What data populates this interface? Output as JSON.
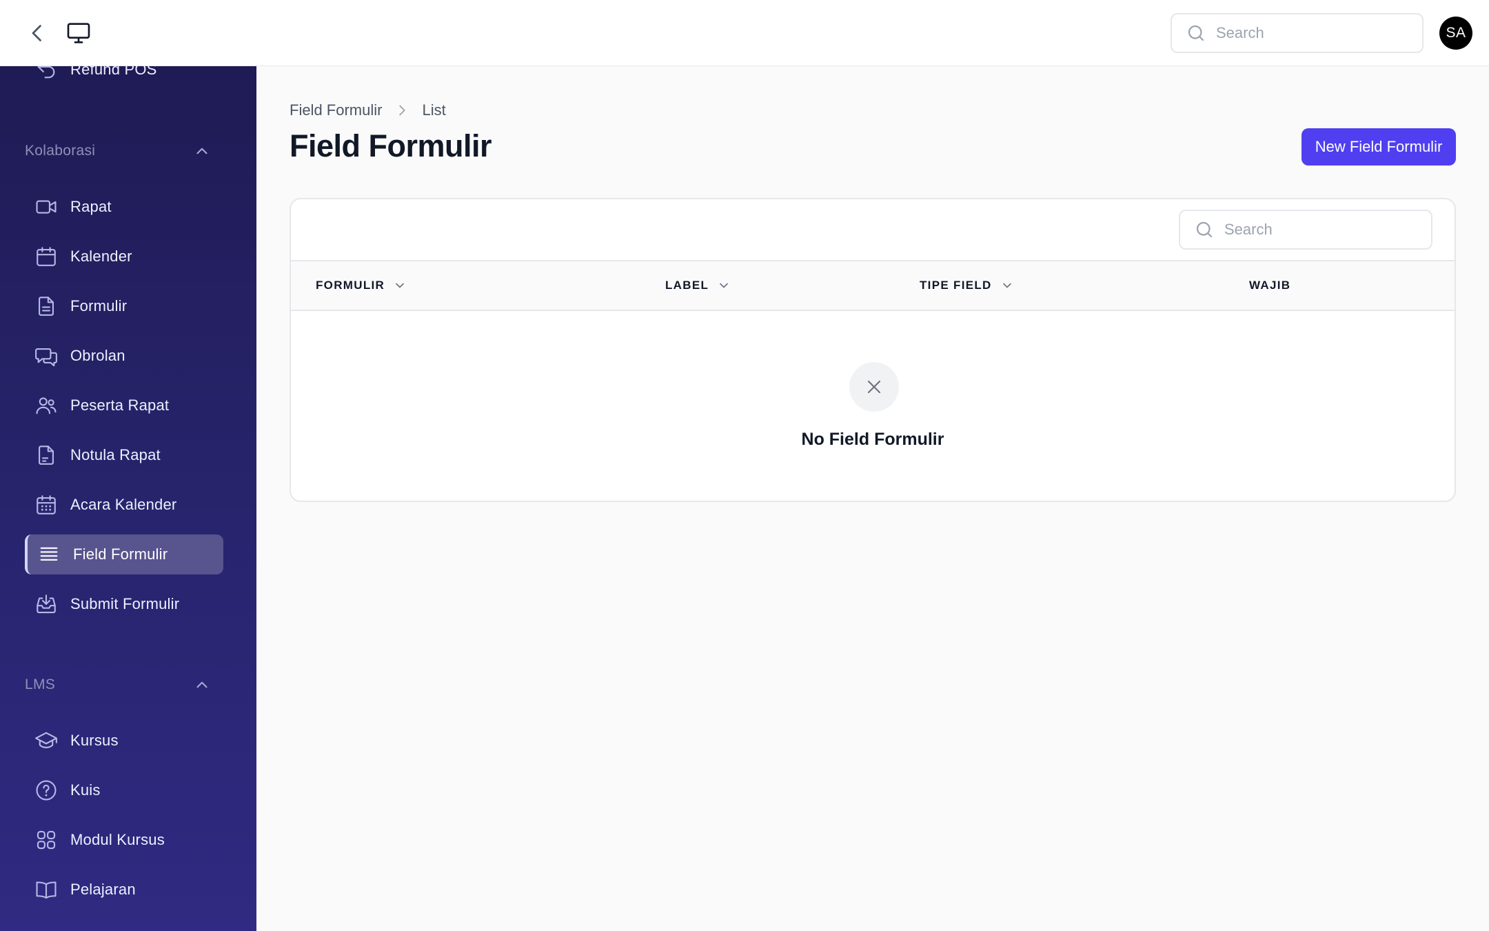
{
  "topbar": {
    "search_placeholder": "Search",
    "avatar_initials": "SA"
  },
  "sidebar": {
    "partial_item": {
      "label": "Refund POS",
      "icon": "undo-icon"
    },
    "groups": [
      {
        "label": "Kolaborasi",
        "expanded": true,
        "items": [
          {
            "label": "Rapat",
            "icon": "video-icon"
          },
          {
            "label": "Kalender",
            "icon": "calendar-icon"
          },
          {
            "label": "Formulir",
            "icon": "document-icon"
          },
          {
            "label": "Obrolan",
            "icon": "chat-icon"
          },
          {
            "label": "Peserta Rapat",
            "icon": "users-icon"
          },
          {
            "label": "Notula Rapat",
            "icon": "document-text-icon"
          },
          {
            "label": "Acara Kalender",
            "icon": "calendar-days-icon"
          },
          {
            "label": "Field Formulir",
            "icon": "list-icon",
            "active": true
          },
          {
            "label": "Submit Formulir",
            "icon": "inbox-download-icon"
          }
        ]
      },
      {
        "label": "LMS",
        "expanded": true,
        "items": [
          {
            "label": "Kursus",
            "icon": "academic-cap-icon"
          },
          {
            "label": "Kuis",
            "icon": "question-circle-icon"
          },
          {
            "label": "Modul Kursus",
            "icon": "grid-icon"
          },
          {
            "label": "Pelajaran",
            "icon": "book-open-icon"
          }
        ]
      }
    ]
  },
  "breadcrumb": {
    "parent": "Field Formulir",
    "current": "List"
  },
  "page": {
    "title": "Field Formulir",
    "new_button_label": "New Field Formulir"
  },
  "table": {
    "search_placeholder": "Search",
    "columns": [
      {
        "label": "FORMULIR",
        "sortable": true
      },
      {
        "label": "LABEL",
        "sortable": true
      },
      {
        "label": "TIPE FIELD",
        "sortable": true
      },
      {
        "label": "WAJIB",
        "sortable": false
      }
    ],
    "empty_state": "No Field Formulir"
  },
  "colors": {
    "primary": "#4f3ff0",
    "sidebar_top": "#1f1b55",
    "sidebar_bottom": "#302a82",
    "avatar_bg": "#000000"
  }
}
